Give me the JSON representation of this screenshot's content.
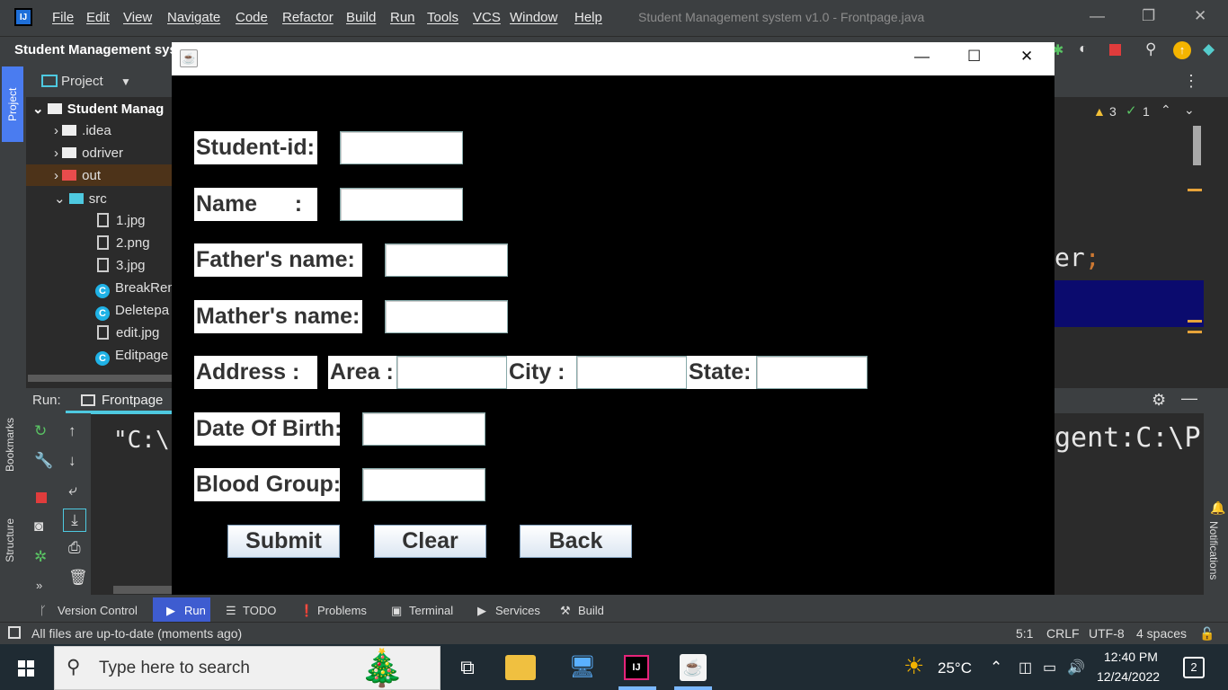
{
  "ide": {
    "menu": [
      "File",
      "Edit",
      "View",
      "Navigate",
      "Code",
      "Refactor",
      "Build",
      "Run",
      "Tools",
      "VCS",
      "Window",
      "Help"
    ],
    "window_title": "Student Management system v1.0 - Frontpage.java",
    "project_crumb": "Student Management sys",
    "project_panel_label": "Project",
    "tree": {
      "root": "Student Manag",
      "idea": ".idea",
      "odriver": "odriver",
      "out": "out",
      "src": "src",
      "f1": "1.jpg",
      "f2": "2.png",
      "f3": "3.jpg",
      "c1": "BreakRem",
      "c2": "Deletepa",
      "f4": "edit.jpg",
      "c3": "Editpage"
    },
    "run_label": "Run:",
    "run_tab": "Frontpage",
    "console_left": "\"C:\\",
    "editor_code": "er",
    "editor_semicolon": ";",
    "warnings": "3",
    "checks": "1",
    "run_right": "gent:C:\\P",
    "side_tabs": {
      "project": "Project",
      "bookmarks": "Bookmarks",
      "structure": "Structure",
      "notifications": "Notifications"
    },
    "bottom_tools": [
      "Version Control",
      "Run",
      "TODO",
      "Problems",
      "Terminal",
      "Services",
      "Build"
    ],
    "status": "All files are up-to-date (moments ago)",
    "status_right": {
      "pos": "5:1",
      "eol": "CRLF",
      "enc": "UTF-8",
      "indent": "4 spaces"
    }
  },
  "form": {
    "student_id_label": "Student-id:",
    "name_label": "Name      :",
    "father_label": "Father's name:",
    "mother_label": "Mather's name:",
    "address_label": "Address :",
    "area_label": "Area :",
    "city_label": "City :",
    "state_label": "State:",
    "dob_label": "Date Of Birth:",
    "blood_label": "Blood Group:",
    "submit": "Submit",
    "clear": "Clear",
    "back": "Back"
  },
  "taskbar": {
    "search_placeholder": "Type here to search",
    "temperature": "25°C",
    "time": "12:40 PM",
    "date": "12/24/2022",
    "notifications": "2"
  }
}
